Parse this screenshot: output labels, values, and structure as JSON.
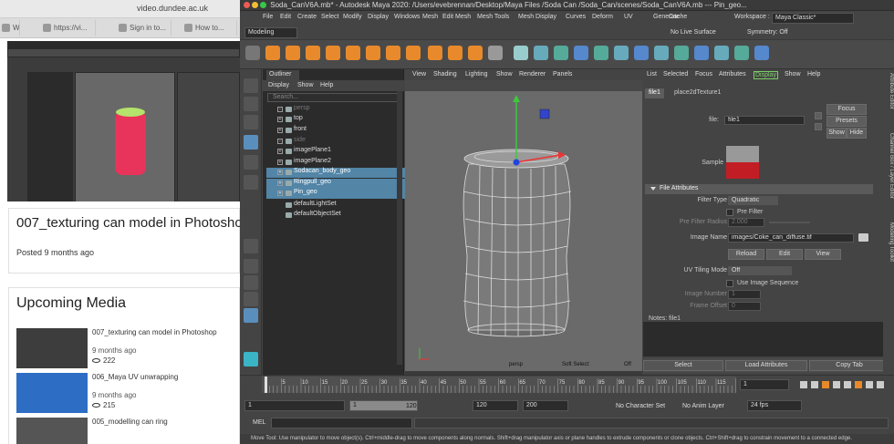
{
  "browser": {
    "tabs": [
      "WIX",
      "https://vi...",
      "Sign in to...",
      "How to..."
    ],
    "url": "video.dundee.ac.uk",
    "video_title": "007_texturing can model in Photoshop",
    "posted": "Posted 9 months ago",
    "upcoming_heading": "Upcoming Media",
    "media": [
      {
        "title": "007_texturing can model in Photoshop",
        "age": "9 months ago",
        "views": "222"
      },
      {
        "title": "006_Maya UV unwrapping",
        "age": "9 months ago",
        "views": "215"
      },
      {
        "title": "005_modelling can ring",
        "age": "9 months ago",
        "views": ""
      }
    ]
  },
  "maya": {
    "title": "Soda_CanV6A.mb* - Autodesk Maya 2020: /Users/evebrennan/Desktop/Maya Files /Soda Can /Soda_Can/scenes/Soda_CanV6A.mb   ---   Pin_geo...",
    "menus": [
      "File",
      "Edit",
      "Create",
      "Select",
      "Modify",
      "Display",
      "Windows",
      "Mesh",
      "Edit Mesh",
      "Mesh Tools",
      "Mesh Display",
      "Curves",
      "Deform",
      "UV",
      "Generate",
      "Cache"
    ],
    "workspace_label": "Workspace :",
    "workspace_value": "Maya Classic*",
    "mode": "Modeling",
    "no_live_surface": "No Live Surface",
    "symmetry": "Symmetry: Off",
    "outliner": {
      "tab": "Outliner",
      "menu": [
        "Display",
        "Show",
        "Help"
      ],
      "search_placeholder": "Search...",
      "items": [
        {
          "name": "persp",
          "state": "dim"
        },
        {
          "name": "top",
          "state": "normal"
        },
        {
          "name": "front",
          "state": "normal"
        },
        {
          "name": "side",
          "state": "dim"
        },
        {
          "name": "imagePlane1",
          "state": "normal"
        },
        {
          "name": "imagePlane2",
          "state": "normal"
        },
        {
          "name": "Sodacan_body_geo",
          "state": "selected"
        },
        {
          "name": "Ringpull_geo",
          "state": "selected"
        },
        {
          "name": "Pin_geo",
          "state": "selected"
        },
        {
          "name": "defaultLightSet",
          "state": "normal"
        },
        {
          "name": "defaultObjectSet",
          "state": "normal"
        }
      ]
    },
    "viewport": {
      "menu": [
        "View",
        "Shading",
        "Lighting",
        "Show",
        "Renderer",
        "Panels"
      ],
      "camera": "persp",
      "soft_select_label": "Soft Select:",
      "soft_select_value": "Off"
    },
    "attribute_editor": {
      "menu": [
        "List",
        "Selected",
        "Focus",
        "Attributes",
        "Display",
        "Show",
        "Help"
      ],
      "tabs": [
        "file1",
        "place2dTexture1"
      ],
      "file_label": "file:",
      "file_value": "file1",
      "focus": "Focus",
      "presets": "Presets",
      "show": "Show",
      "hide": "Hide",
      "sample_label": "Sample",
      "section": "File Attributes",
      "filter_type_label": "Filter Type",
      "filter_type_value": "Quadratic",
      "pre_filter_label": "Pre Filter",
      "pre_filter_radius_label": "Pre Filter Radius",
      "pre_filter_radius_value": "2.000",
      "image_name_label": "Image Name",
      "image_name_value": "images/Coke_can_diffuse.tif",
      "reload": "Reload",
      "edit": "Edit",
      "view": "View",
      "uv_tiling_label": "UV Tiling Mode",
      "uv_tiling_value": "Off",
      "use_image_seq": "Use Image Sequence",
      "image_number_label": "Image Number",
      "image_number_value": "1",
      "frame_offset_label": "Frame Offset",
      "frame_offset_value": "0",
      "notes": "Notes:  file1",
      "select": "Select",
      "load_attributes": "Load Attributes",
      "copy_tab": "Copy Tab"
    },
    "side_tabs": [
      "Attribute Editor",
      "Channel Box / Layer Editor",
      "Modeling Toolkit"
    ],
    "timeline": {
      "ticks": [
        "5",
        "10",
        "15",
        "20",
        "25",
        "30",
        "35",
        "40",
        "45",
        "50",
        "55",
        "60",
        "65",
        "70",
        "75",
        "80",
        "85",
        "90",
        "95",
        "100",
        "105",
        "110",
        "115",
        "120"
      ],
      "current_frame": "1",
      "range_start": "1",
      "range_inner_start": "1",
      "range_inner_end": "120",
      "range_end_a": "120",
      "range_end_b": "200",
      "no_character_set": "No Character Set",
      "no_anim_layer": "No Anim Layer",
      "fps": "24 fps"
    },
    "mel": "MEL",
    "helpline": "Move Tool: Use manipulator to move object(s). Ctrl+middle-drag to move components along normals. Shift+drag manipulator axis or plane handles to extrude components or clone objects. Ctrl+Shift+drag to constrain movement to a connected edge."
  }
}
